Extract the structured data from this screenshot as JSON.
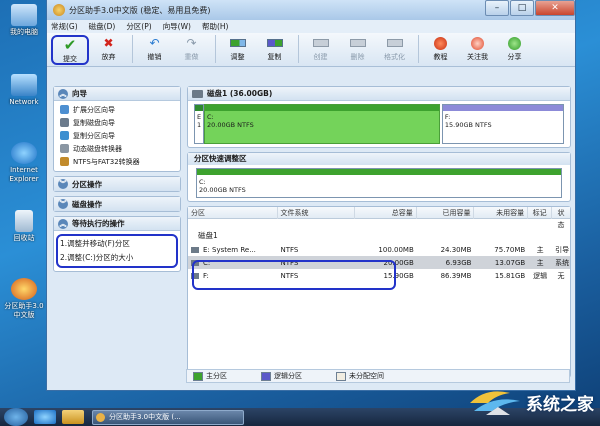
{
  "desktop": {
    "icons": [
      {
        "name": "my-computer",
        "label": "我的电脑"
      },
      {
        "name": "network",
        "label": "Network"
      },
      {
        "name": "ie",
        "label": "Internet Explorer"
      },
      {
        "name": "recycle-bin",
        "label": "回收站"
      },
      {
        "name": "partition-assistant",
        "label": "分区助手3.0中文版"
      }
    ]
  },
  "window": {
    "title": "分区助手3.0中文版 (稳定、易用且免费)",
    "min": "–",
    "max": "□",
    "close": "✕"
  },
  "menu": {
    "items": [
      "常规(G)",
      "磁盘(D)",
      "分区(P)",
      "向导(W)",
      "帮助(H)"
    ]
  },
  "toolbar": {
    "commit": "提交",
    "discard": "放弃",
    "undo": "撤销",
    "redo": "重做",
    "adjust": "调整",
    "copy": "复制",
    "create": "创建",
    "delete": "删除",
    "format": "格式化",
    "tutorial": "教程",
    "follow": "关注我",
    "share": "分享"
  },
  "left": {
    "wizard": {
      "title": "向导",
      "items": [
        "扩展分区向导",
        "复制磁盘向导",
        "复制分区向导",
        "动态磁盘转换器",
        "NTFS与FAT32转换器"
      ]
    },
    "partition_ops": "分区操作",
    "disk_ops": "磁盘操作",
    "pending": {
      "title": "等待执行的操作",
      "items": [
        "1.调整并移动(F)分区",
        "2.调整(C:)分区的大小"
      ]
    }
  },
  "disk": {
    "title": "磁盘1 (36.00GB)",
    "segments": {
      "sys_letter": "E",
      "sys_num": "1",
      "c_label": "C:",
      "c_info": "20.00GB NTFS",
      "f_label": "F:",
      "f_info": "15.90GB NTFS"
    }
  },
  "resize": {
    "title": "分区快速调整区",
    "label": "C:",
    "info": "20.00GB NTFS"
  },
  "table": {
    "headers": [
      "分区",
      "文件系统",
      "总容量",
      "已用容量",
      "未用容量",
      "标记",
      "状态"
    ],
    "disk_label": "磁盘1",
    "rows": [
      {
        "name": "E: System Re...",
        "fs": "NTFS",
        "total": "100.00MB",
        "used": "24.30MB",
        "free": "75.70MB",
        "flag": "主",
        "status": "引导"
      },
      {
        "name": "C:",
        "fs": "NTFS",
        "total": "20.00GB",
        "used": "6.93GB",
        "free": "13.07GB",
        "flag": "主",
        "status": "系统"
      },
      {
        "name": "F:",
        "fs": "NTFS",
        "total": "15.90GB",
        "used": "86.39MB",
        "free": "15.81GB",
        "flag": "逻辑",
        "status": "无"
      }
    ]
  },
  "legend": {
    "primary": "主分区",
    "logical": "逻辑分区",
    "unallocated": "未分配空间",
    "colors": {
      "primary": "#3da22e",
      "logical": "#5b58c9",
      "unallocated": "#f1ede2"
    }
  },
  "taskbar": {
    "app_button": "分区助手3.0中文版 (..."
  },
  "watermark": {
    "text": "系统之家"
  }
}
